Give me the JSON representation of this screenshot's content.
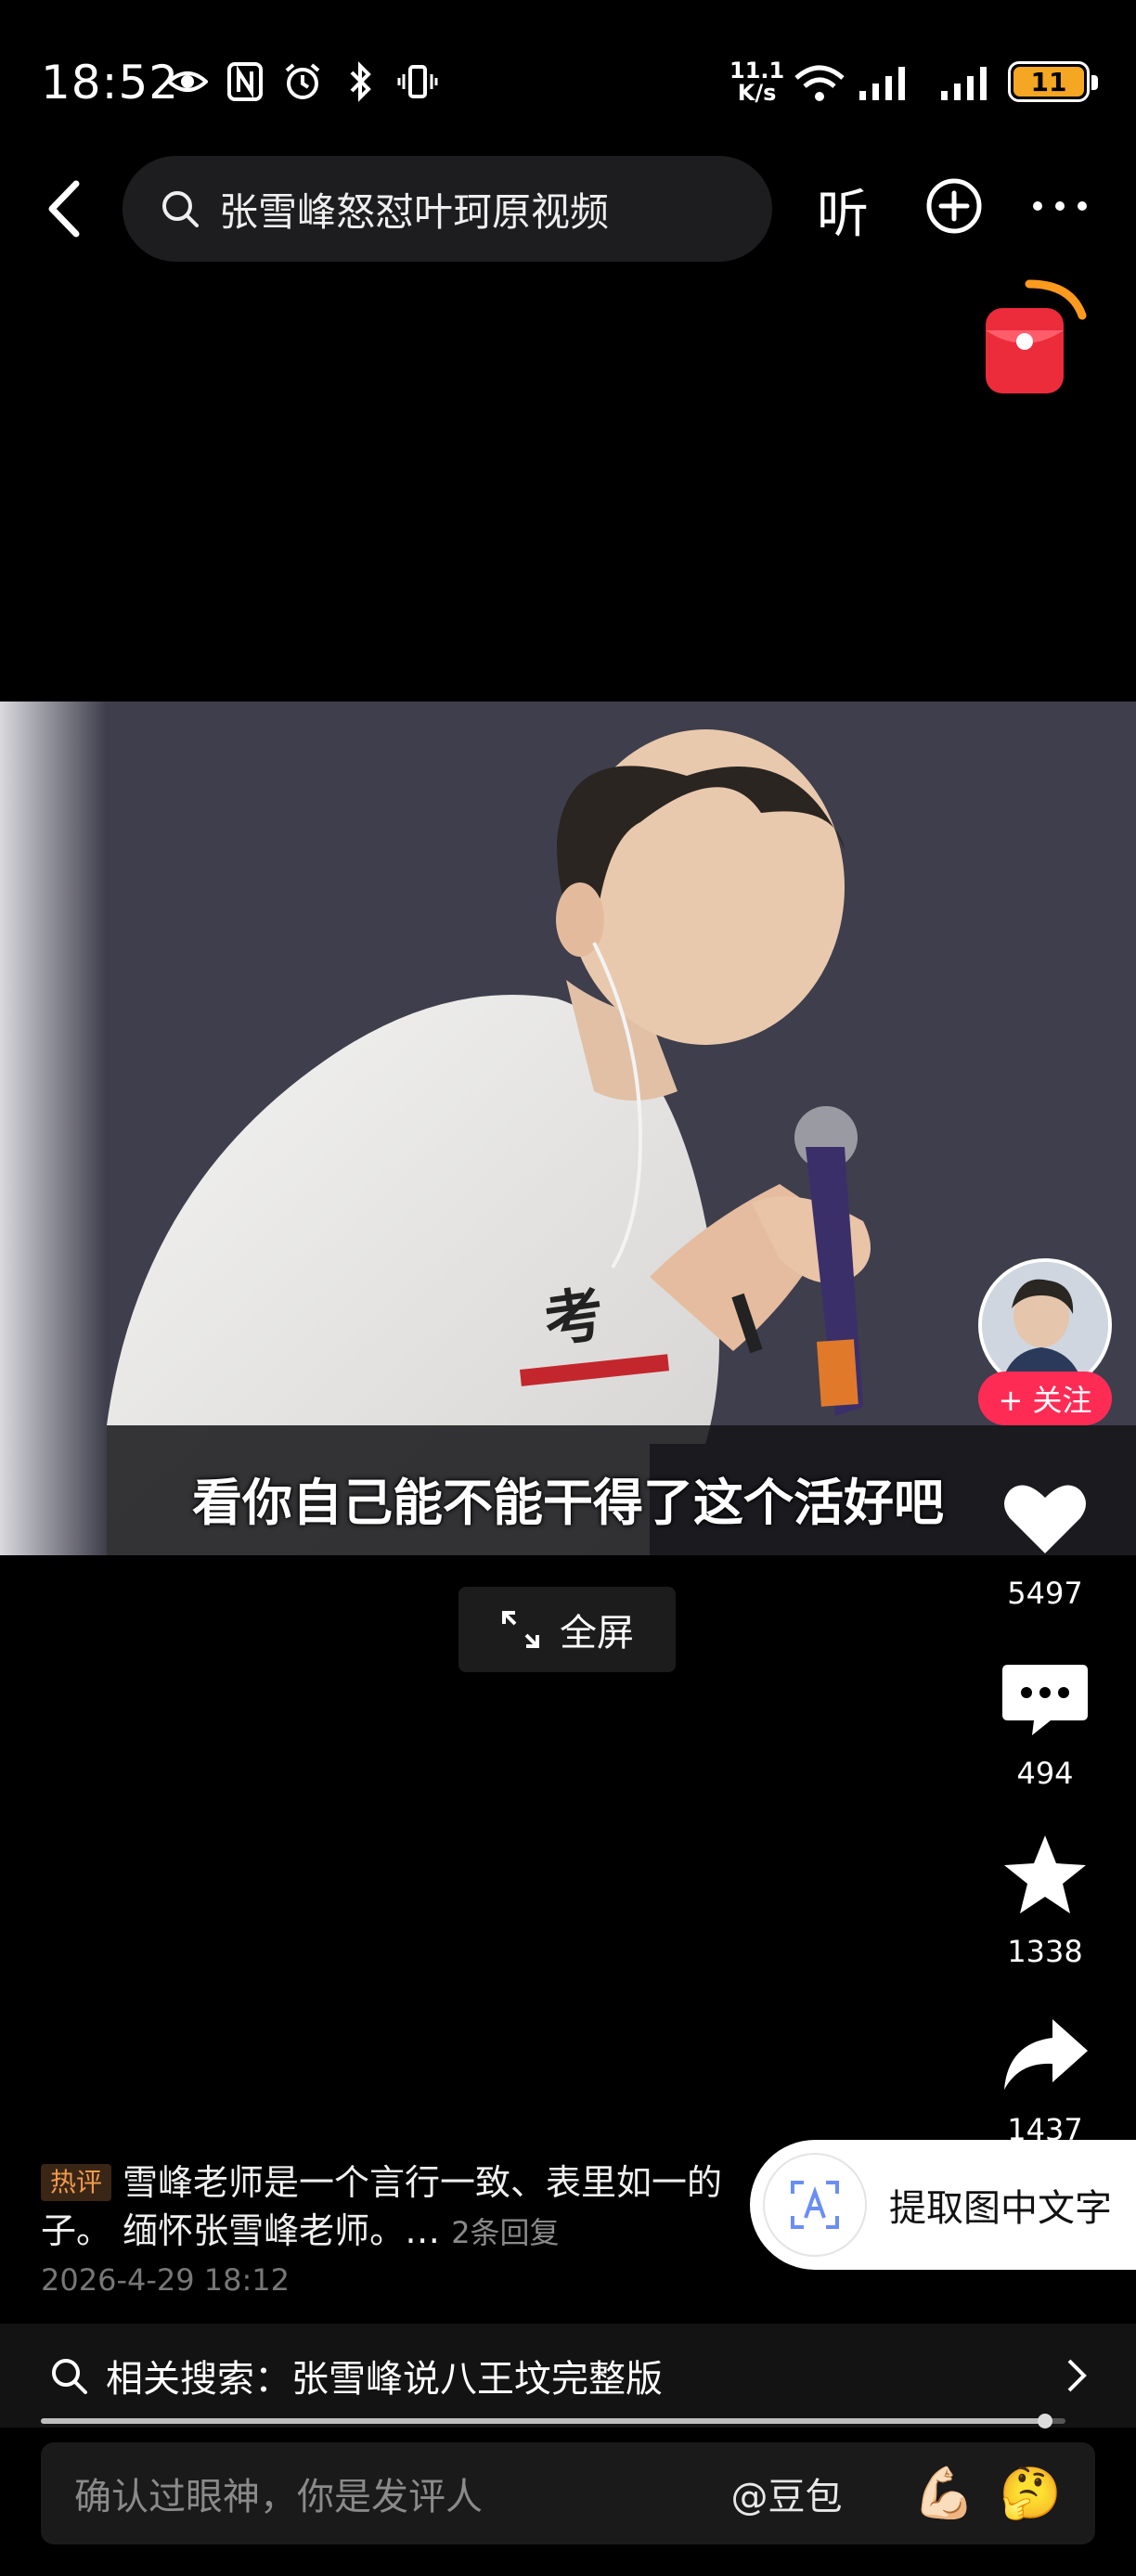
{
  "status_bar": {
    "time": "18:52",
    "net_speed_value": "11.1",
    "net_speed_unit": "K/s",
    "battery": "11",
    "battery_level_percent": 11
  },
  "header": {
    "search_text": "张雪峰怒怼叶珂原视频",
    "listen_label": "听"
  },
  "video": {
    "subtitle": "看你自己能不能干得了这个活好吧",
    "shirt_text": "考"
  },
  "fullscreen": {
    "label": "全屏"
  },
  "actions": {
    "follow_label": "+ 关注",
    "likes": "5497",
    "comments": "494",
    "favorites": "1338",
    "shares": "1437"
  },
  "hot_comment": {
    "tag": "热评",
    "text": "雪峰老师是一个言行一致、表里如一的",
    "text_line2": "子。 缅怀张雪峰老师。…",
    "replies": "2条回复",
    "timestamp": "2026-4-29 18:12"
  },
  "extract": {
    "label": "提取图中文字"
  },
  "related_search": {
    "text": "相关搜索：张雪峰说八王坟完整版"
  },
  "playback": {
    "progress_fraction": 0.98
  },
  "comment_input": {
    "placeholder": "确认过眼神，你是发评人",
    "mention": "@豆包",
    "emoji1": "💪🏻",
    "emoji2": "🤔"
  },
  "colors": {
    "accent_red": "#fe2c55",
    "battery_orange": "#f5a623",
    "hot_tag": "#f09a4a"
  }
}
